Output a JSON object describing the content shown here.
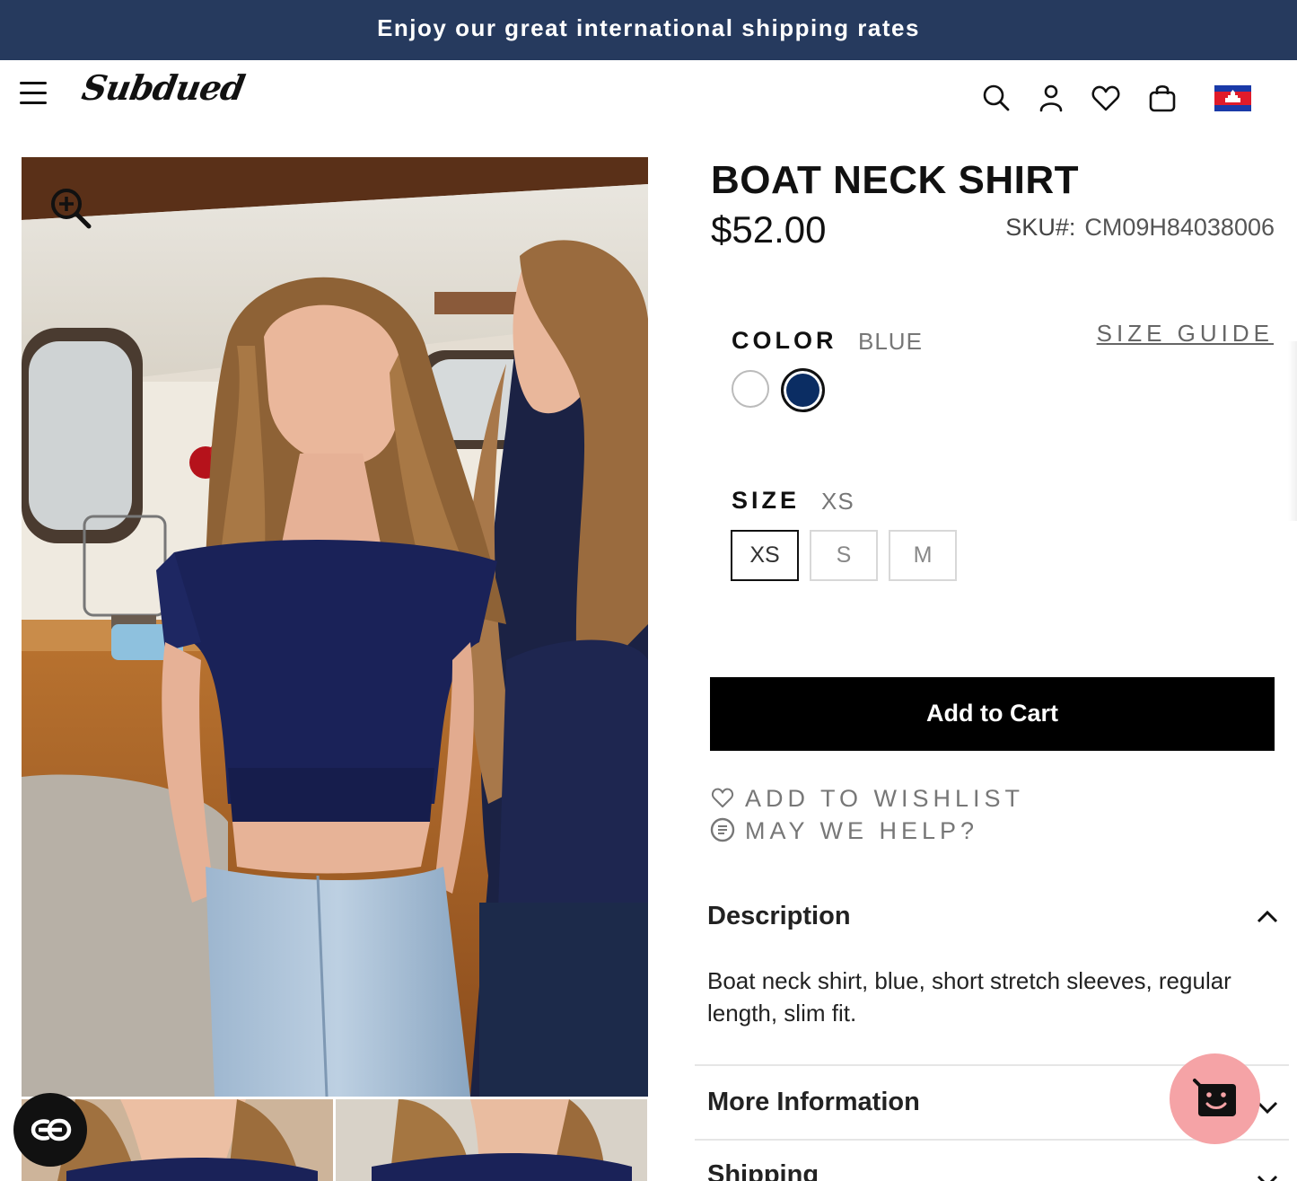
{
  "announcement": "Enjoy our great international shipping rates",
  "header": {
    "logo": "Subdued",
    "icons": [
      "menu-icon",
      "search-icon",
      "account-icon",
      "heart-icon",
      "bag-icon",
      "flag-icon"
    ]
  },
  "product": {
    "title": "BOAT NECK SHIRT",
    "price": "$52.00",
    "sku_label": "SKU#:",
    "sku_value": "CM09H84038006",
    "color_label": "COLOR",
    "color_value": "BLUE",
    "size_guide": "SIZE GUIDE",
    "colors": [
      {
        "name": "white",
        "hex": "#ffffff"
      },
      {
        "name": "blue",
        "hex": "#0b2d63",
        "selected": true
      }
    ],
    "size_label": "SIZE",
    "size_value": "XS",
    "sizes": [
      "XS",
      "S",
      "M"
    ],
    "selected_size": "XS",
    "add_to_cart": "Add to Cart",
    "add_to_wishlist": "ADD TO WISHLIST",
    "may_we_help": "MAY WE HELP?"
  },
  "accordion": {
    "description_title": "Description",
    "description_text": "Boat neck shirt, blue, short stretch sleeves, regular length, slim fit.",
    "more_info_title": "More Information",
    "shipping_title": "Shipping"
  },
  "colors": {
    "announcement_bg": "#263a5e",
    "cart_button": "#000000",
    "chat_button": "#f5a3a6"
  }
}
